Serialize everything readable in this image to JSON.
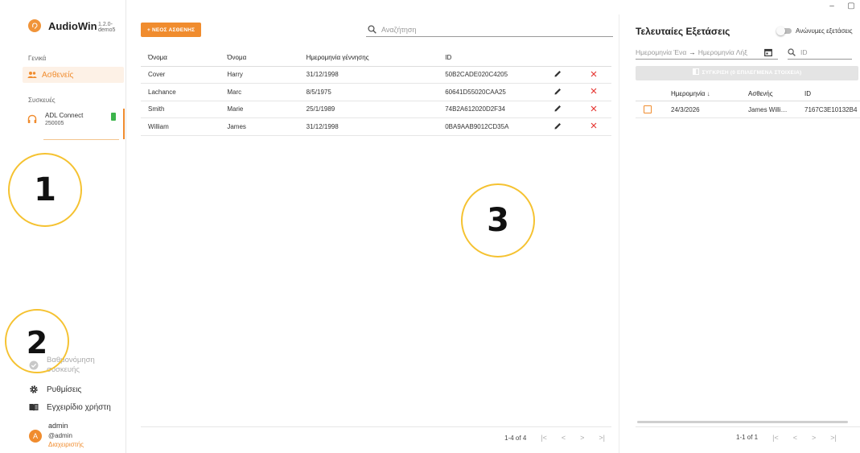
{
  "window": {
    "minimize": "–",
    "maximize": "▢",
    "close": ""
  },
  "app": {
    "name": "AudioWin",
    "version": "1.2.0-demo5"
  },
  "sidebar": {
    "general_label": "Γενικά",
    "patients_item": "Ασθενείς",
    "devices_label": "Συσκευές",
    "device": {
      "name": "ADL Connect",
      "serial": "250005"
    },
    "calibration": "Βαθμονόμηση συσκευής",
    "settings": "Ρυθμίσεις",
    "manual": "Εγχειρίδιο χρήστη",
    "user": {
      "initial": "A",
      "name": "admin",
      "handle": "@admin",
      "role": "Διαχειριστής"
    }
  },
  "annotations": {
    "one": "1",
    "two": "2",
    "three": "3"
  },
  "main": {
    "new_patient_button": "+ ΝΕΟΣ ΑΣΘΕΝΗΣ",
    "search_placeholder": "Αναζήτηση",
    "columns": [
      "Όνομα",
      "Όνομα",
      "Ημερομηνία γέννησης",
      "ID"
    ],
    "rows": [
      {
        "last": "Cover",
        "first": "Harry",
        "dob": "31/12/1998",
        "id": "50B2CADE020C4205"
      },
      {
        "last": "Lachance",
        "first": "Marc",
        "dob": "8/5/1975",
        "id": "60641D55020CAA25"
      },
      {
        "last": "Smith",
        "first": "Marie",
        "dob": "25/1/1989",
        "id": "74B2A612020D2F34"
      },
      {
        "last": "William",
        "first": "James",
        "dob": "31/12/1998",
        "id": "0BA9AAB9012CD35A"
      }
    ],
    "pager": {
      "range": "1-4 of 4",
      "first": "|<",
      "prev": "<",
      "next": ">",
      "last": ">|"
    }
  },
  "right": {
    "title": "Τελευταίες Εξετάσεις",
    "anonymous_label": "Ανώνυμες εξετάσεις",
    "date_start_placeholder": "Ημερομηνία Ένα",
    "arrow": "→",
    "date_end_placeholder": "Ημερομηνία Λήξ",
    "id_placeholder": "ID",
    "compare_button": "ΣΥΓΚΡΙΣΗ (0 ΕΠΙΛΕΓΜΕΝΑ ΣΤΟΙΧΕΙΑ)",
    "columns": {
      "date": "Ημερομηνία",
      "sort": "↓",
      "patient": "Ασθενής",
      "id": "ID"
    },
    "rows": [
      {
        "date": "24/3/2026",
        "patient": "James Willi…",
        "id": "7167C3E10132B4"
      }
    ],
    "pager": {
      "range": "1-1 of 1",
      "first": "|<",
      "prev": "<",
      "next": ">",
      "last": ">|"
    }
  },
  "colors": {
    "accent": "#f08c2e",
    "danger": "#e53935",
    "annotation": "#f5c231"
  }
}
